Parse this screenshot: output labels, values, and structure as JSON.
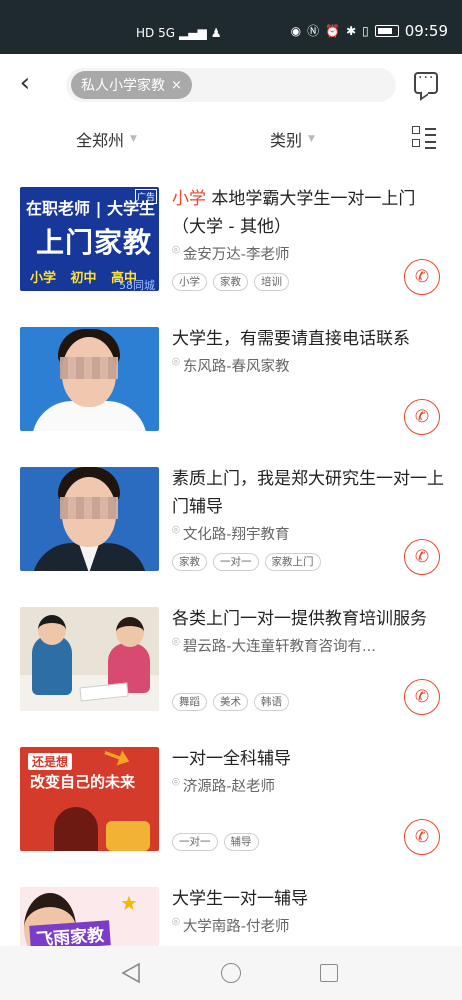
{
  "status_bar": {
    "network": "HD 5G",
    "time": "09:59"
  },
  "header": {
    "search_tag": "私人小学家教",
    "search_tag_close": "×"
  },
  "filters": {
    "region": "全郑州",
    "category": "类别"
  },
  "listings": [
    {
      "title_highlight": "小学",
      "title": " 本地学霸大学生一对一上门（大学 - 其他）",
      "location": "金安万达-李老师",
      "tags": [
        "小学",
        "家教",
        "培训"
      ],
      "thumb_text": {
        "line1": "在职老师 | 大学生",
        "line2": "上门家教",
        "line3": "小学 初中 高中",
        "brand": "58同城",
        "ad": "广告"
      }
    },
    {
      "title": "大学生，有需要请直接电话联系",
      "location": "东风路-春风家教",
      "tags": []
    },
    {
      "title": "素质上门，我是郑大研究生一对一上门辅导",
      "location": "文化路-翔宇教育",
      "tags": [
        "家教",
        "一对一",
        "家教上门"
      ]
    },
    {
      "title": "各类上门一对一提供教育培训服务",
      "location": "碧云路-大连童轩教育咨询有...",
      "tags": [
        "舞蹈",
        "美术",
        "韩语"
      ]
    },
    {
      "title": "一对一全科辅导",
      "location": "济源路-赵老师",
      "tags": [
        "一对一",
        "辅导"
      ],
      "thumb_text": {
        "pill": "还是想",
        "big": "改变自己的未来"
      }
    },
    {
      "title": "大学生一对一辅导",
      "location": "大学南路-付老师",
      "tags": [],
      "thumb_text": {
        "banner": "飞雨家教"
      }
    }
  ],
  "colors": {
    "accent": "#e8472b",
    "status_bar": "#1f2a2e"
  },
  "icons": [
    "back-arrow-icon",
    "message-icon",
    "list-mode-icon",
    "location-pin-icon",
    "phone-icon",
    "nav-back-icon",
    "nav-home-icon",
    "nav-recent-icon"
  ]
}
